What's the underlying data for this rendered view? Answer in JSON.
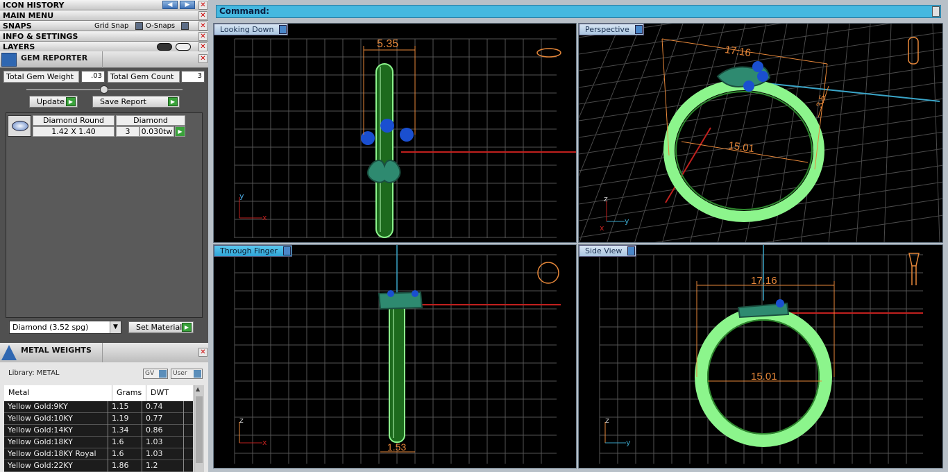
{
  "menus": {
    "icon_history": "ICON HISTORY",
    "main_menu": "MAIN MENU",
    "snaps": "SNAPS",
    "grid_snap": "Grid Snap",
    "o_snaps": "O-Snaps",
    "info_settings": "INFO & SETTINGS",
    "layers": "LAYERS"
  },
  "gem_reporter": {
    "title": "GEM REPORTER",
    "total_weight_label": "Total Gem Weight",
    "total_weight_value": ".03",
    "total_count_label": "Total Gem Count",
    "total_count_value": "3",
    "update_label": "Update",
    "save_label": "Save Report",
    "row": {
      "shape": "Diamond Round",
      "size": "1.42 X 1.40",
      "material": "Diamond",
      "count": "3",
      "weight": "0.030tw"
    },
    "material_select": "Diamond      (3.52 spg)",
    "set_material_label": "Set Material"
  },
  "metal_weights": {
    "title": "METAL WEIGHTS",
    "library": "Library: METAL",
    "gv_label": "GV",
    "user_label": "User",
    "columns": [
      "Metal",
      "Grams",
      "DWT"
    ],
    "rows": [
      [
        "Yellow Gold:9KY",
        "1.15",
        "0.74"
      ],
      [
        "Yellow Gold:10KY",
        "1.19",
        "0.77"
      ],
      [
        "Yellow Gold:14KY",
        "1.34",
        "0.86"
      ],
      [
        "Yellow Gold:18KY",
        "1.6",
        "1.03"
      ],
      [
        "Yellow Gold:18KY Royal",
        "1.6",
        "1.03"
      ],
      [
        "Yellow Gold:22KY",
        "1.86",
        "1.2"
      ]
    ]
  },
  "command_label": "Command:",
  "viewports": {
    "top_left": {
      "label": "Looking Down",
      "dim": "5.35",
      "axis_a": "y",
      "axis_b": "x"
    },
    "top_right": {
      "label": "Perspective",
      "dim_a": "17.16",
      "dim_b": "15.01",
      "dim_c": "3.5",
      "axis_a": "z",
      "axis_b": "y",
      "axis_c": "x"
    },
    "bottom_left": {
      "label": "Through Finger",
      "dim": "1.53",
      "axis_a": "z",
      "axis_b": "x"
    },
    "bottom_right": {
      "label": "Side View",
      "dim_a": "17.16",
      "dim_b": "15.01",
      "axis_a": "z",
      "axis_b": "y"
    }
  },
  "colors": {
    "ring": "#7cf07c",
    "stone": "#1a4fd0",
    "setting": "#2e8a70",
    "dim": "#e8883a",
    "axis_red": "#c0201e",
    "grid": "#5a5a5a"
  }
}
